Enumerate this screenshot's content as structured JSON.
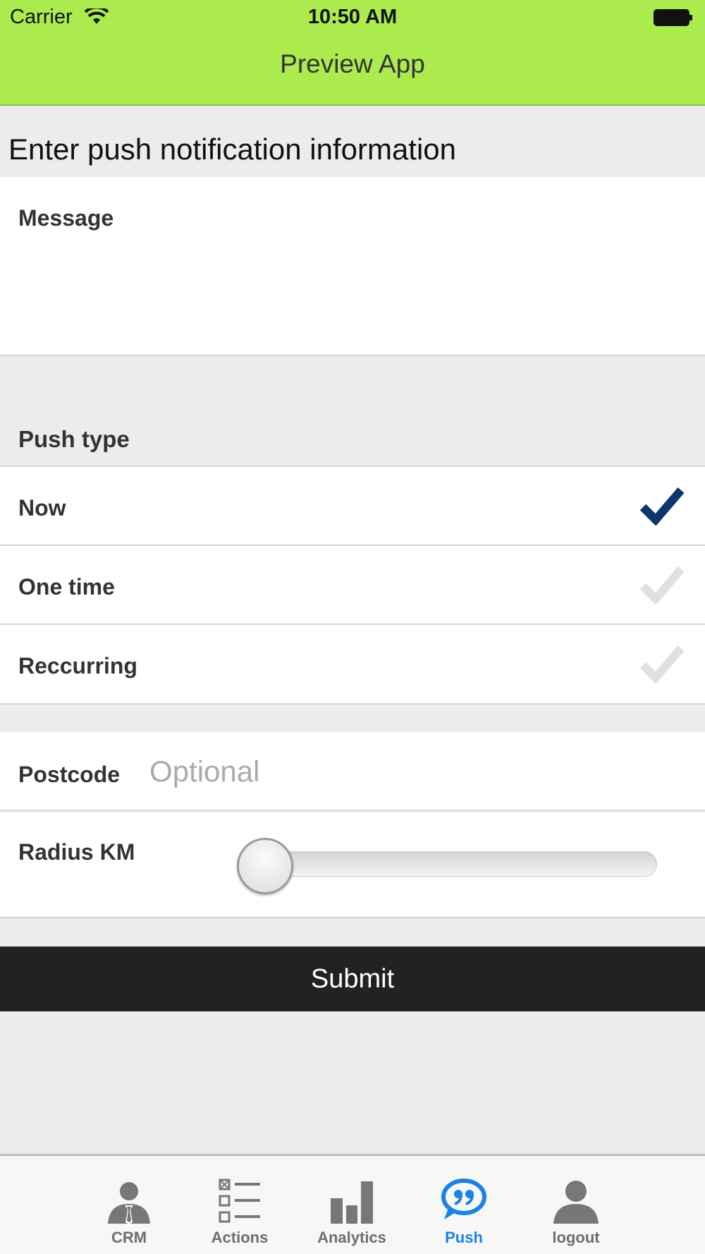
{
  "status_bar": {
    "carrier": "Carrier",
    "time": "10:50 AM",
    "wifi_icon": "wifi-icon",
    "battery_icon": "battery-icon"
  },
  "header": {
    "title": "Preview App",
    "color": "#abeb4e"
  },
  "form": {
    "heading": "Enter push notification information",
    "message_label": "Message",
    "push_type_label": "Push type",
    "push_type_options": [
      {
        "label": "Now",
        "selected": true
      },
      {
        "label": "One time",
        "selected": false
      },
      {
        "label": "Reccurring",
        "selected": false
      }
    ],
    "selected_check_color": "#0d3570",
    "unselected_check_color": "#e0e0e0",
    "postcode_label": "Postcode",
    "postcode_placeholder": "Optional",
    "postcode_value": "",
    "radius_label": "Radius KM",
    "radius_value_fraction": 0,
    "submit_label": "Submit"
  },
  "tab_bar": {
    "active_color": "#1a83e6",
    "items": [
      {
        "label": "CRM",
        "icon": "person-tie-icon",
        "active": false
      },
      {
        "label": "Actions",
        "icon": "checklist-icon",
        "active": false
      },
      {
        "label": "Analytics",
        "icon": "bar-chart-icon",
        "active": false
      },
      {
        "label": "Push",
        "icon": "speech-bubble-icon",
        "active": true
      },
      {
        "label": "logout",
        "icon": "user-icon",
        "active": false
      }
    ]
  }
}
